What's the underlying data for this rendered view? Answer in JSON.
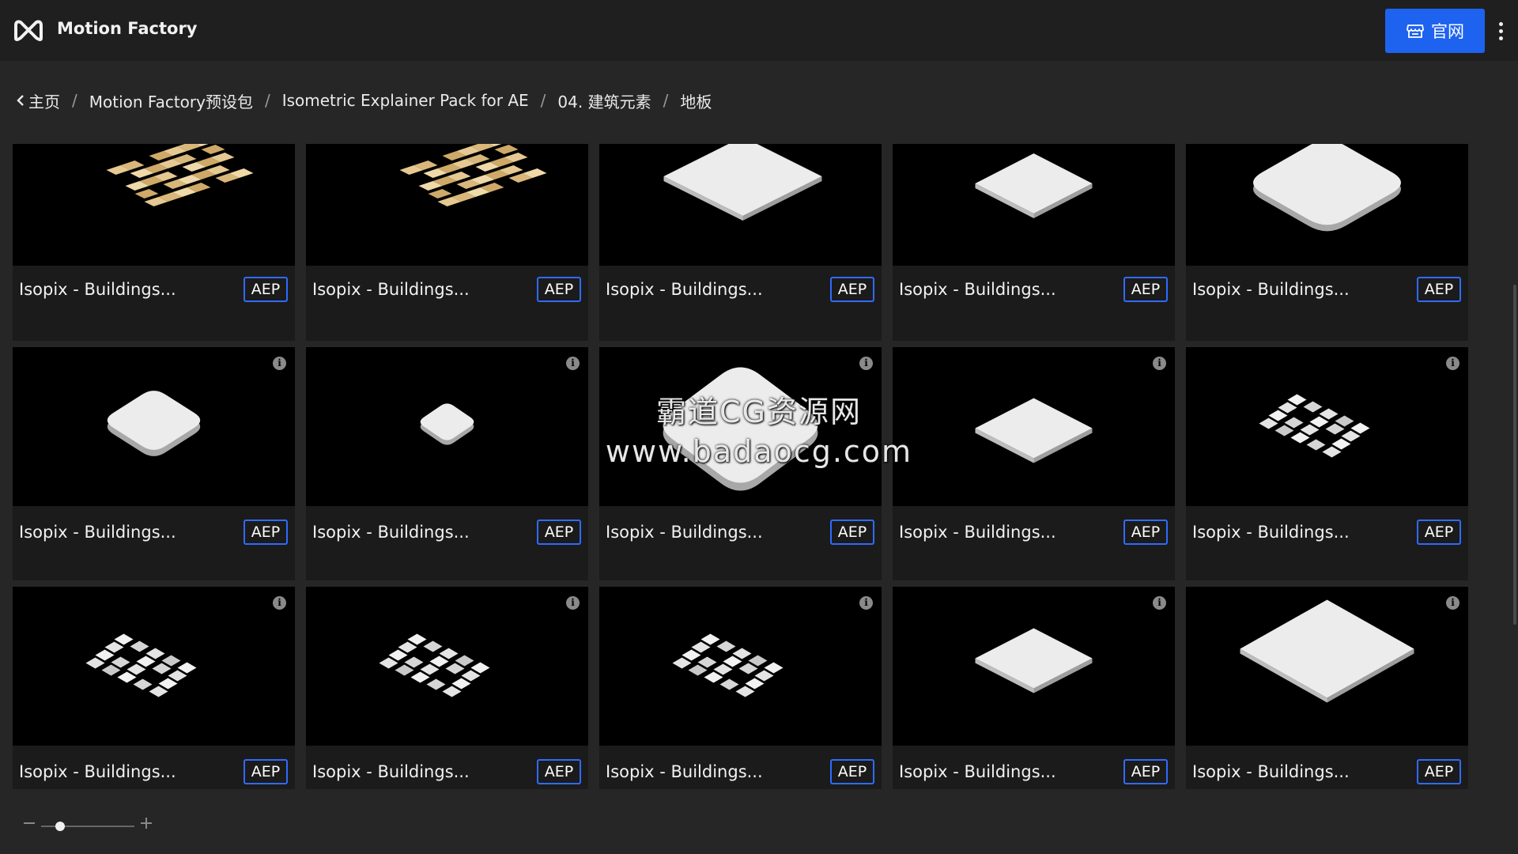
{
  "header": {
    "app_name": "Motion Factory",
    "site_button_label": "官网",
    "accent_color": "#1e63f0"
  },
  "breadcrumb": {
    "items": [
      "主页",
      "Motion Factory预设包",
      "Isometric Explainer Pack for AE",
      "04. 建筑元素",
      "地板"
    ]
  },
  "assets": [
    {
      "title": "Isopix - Buildings...",
      "badge": "AEP",
      "preview": "wood-floor",
      "info": false
    },
    {
      "title": "Isopix - Buildings...",
      "badge": "AEP",
      "preview": "wood-floor",
      "info": false
    },
    {
      "title": "Isopix - Buildings...",
      "badge": "AEP",
      "preview": "large-slab",
      "info": false
    },
    {
      "title": "Isopix - Buildings...",
      "badge": "AEP",
      "preview": "small-slab",
      "info": false
    },
    {
      "title": "Isopix - Buildings...",
      "badge": "AEP",
      "preview": "rounded-slab",
      "info": false
    },
    {
      "title": "Isopix - Buildings...",
      "badge": "AEP",
      "preview": "rounded-slab",
      "info": true
    },
    {
      "title": "Isopix - Buildings...",
      "badge": "AEP",
      "preview": "small-rounded-slab",
      "info": true
    },
    {
      "title": "Isopix - Buildings...",
      "badge": "AEP",
      "preview": "rounded-slab-large",
      "info": true
    },
    {
      "title": "Isopix - Buildings...",
      "badge": "AEP",
      "preview": "small-slab",
      "info": true
    },
    {
      "title": "Isopix - Buildings...",
      "badge": "AEP",
      "preview": "tile-pattern",
      "info": true
    },
    {
      "title": "Isopix - Buildings...",
      "badge": "AEP",
      "preview": "tile-pattern",
      "info": true
    },
    {
      "title": "Isopix - Buildings...",
      "badge": "AEP",
      "preview": "tile-pattern",
      "info": true
    },
    {
      "title": "Isopix - Buildings...",
      "badge": "AEP",
      "preview": "tile-pattern",
      "info": true
    },
    {
      "title": "Isopix - Buildings...",
      "badge": "AEP",
      "preview": "medium-slab",
      "info": true
    },
    {
      "title": "Isopix - Buildings...",
      "badge": "AEP",
      "preview": "large-diamond-slab",
      "info": true
    }
  ],
  "watermark": {
    "line1": "霸道CG资源网",
    "line2": "www.badaocg.com"
  },
  "zoom": {
    "level": 0.2
  }
}
